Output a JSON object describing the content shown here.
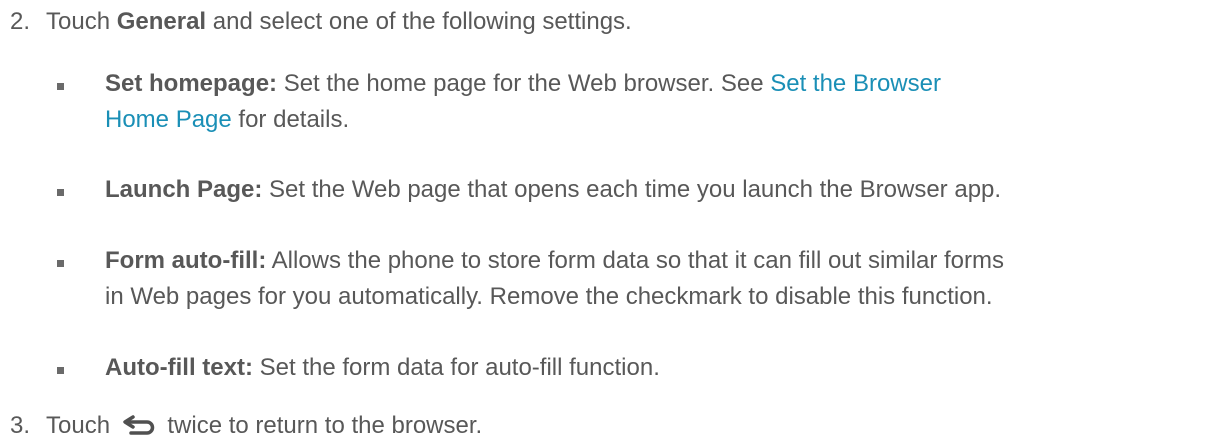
{
  "step2": {
    "number": "2.",
    "text_before": "Touch ",
    "bold": "General",
    "text_after": " and select one of the following settings."
  },
  "bullets": [
    {
      "label": "Set homepage:",
      "text_before": " Set the home page for the Web browser. See ",
      "link": "Set the Browser",
      "link_cont": "Home Page",
      "text_after": " for details."
    },
    {
      "label": "Launch Page:",
      "text": " Set the Web page that opens each time you launch the Browser app."
    },
    {
      "label": "Form auto-fill:",
      "text_line1": " Allows the phone to store form data so that it can fill out similar forms",
      "text_line2": "in Web pages for you automatically. Remove the checkmark to disable this function."
    },
    {
      "label": "Auto-fill text:",
      "text": " Set the form data for auto-fill function."
    }
  ],
  "step3": {
    "number": "3.",
    "text_before": "Touch ",
    "icon": "back-icon",
    "text_after": " twice to return to the browser."
  }
}
